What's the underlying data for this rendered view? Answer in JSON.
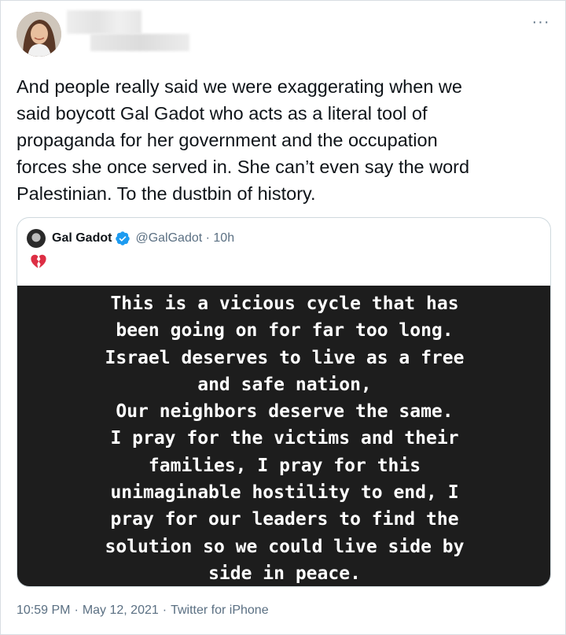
{
  "author": {
    "avatar_icon": "user-avatar-icon"
  },
  "tweet": {
    "text": "And people really said we were exaggerating when we\nsaid boycott Gal Gadot who acts as a literal tool of\npropaganda for her government and the occupation\nforces she once served in. She can’t even say the word\nPalestinian. To the dustbin of history."
  },
  "more_menu": {
    "label": "···"
  },
  "quoted_tweet": {
    "name": "Gal Gadot",
    "handle_time": "@GalGadot · 10h",
    "emoji_icon": "broken-heart-icon",
    "image_text": "This is a vicious cycle that has\nbeen going on for far too long.\nIsrael deserves to live as a free\nand safe nation,\nOur neighbors deserve the same.\nI pray for the victims and their\nfamilies, I pray for this\nunimaginable hostility to end, I\npray for our leaders to find the\nsolution so we could live side by\nside in peace."
  },
  "footer": {
    "time": "10:59 PM",
    "sep1": "·",
    "date": "May 12, 2021",
    "sep2": "·",
    "source": "Twitter for iPhone"
  },
  "colors": {
    "text": "#0f1419",
    "secondary": "#5b7083",
    "verified": "#1d9bf0",
    "image_bg": "#1d1d1d",
    "border": "#cfd9de"
  }
}
